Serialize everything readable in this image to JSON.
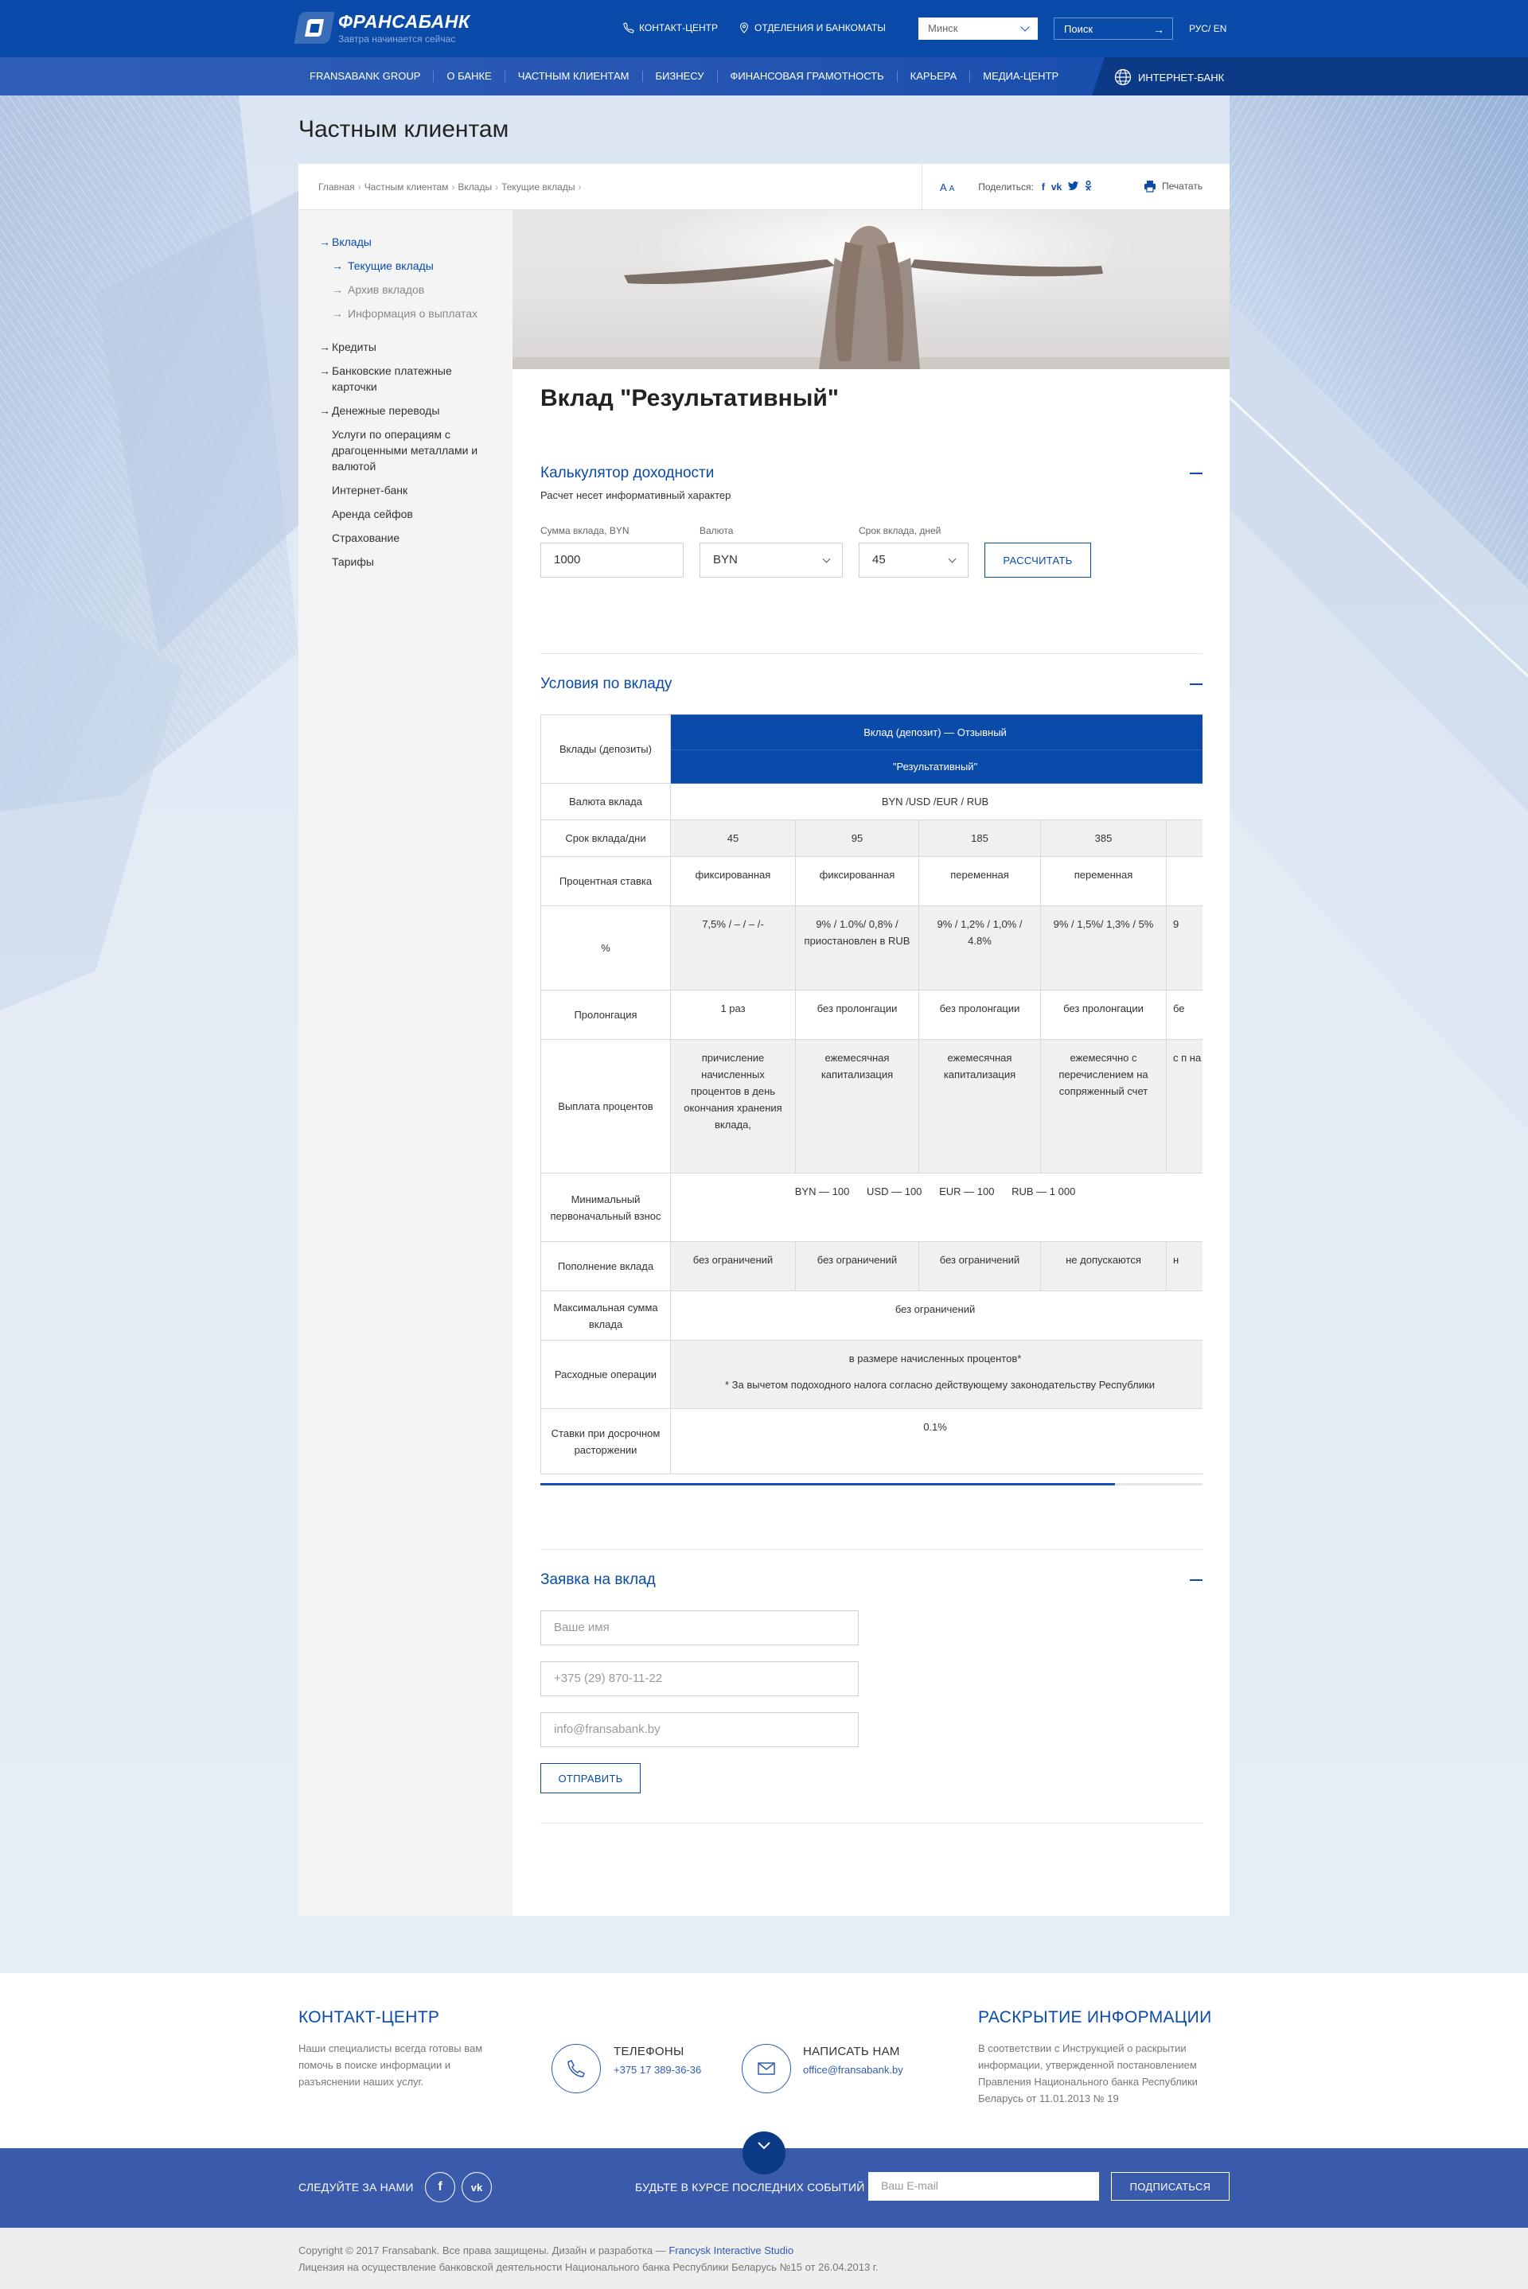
{
  "header": {
    "logo_name": "ФРАНСАБАНК",
    "logo_slogan": "Завтра начинается сейчас",
    "contact_center": "КОНТАКТ-ЦЕНТР",
    "branches": "ОТДЕЛЕНИЯ И БАНКОМАТЫ",
    "city": "Минск",
    "search_placeholder": "Поиск",
    "lang": "РУС/ EN"
  },
  "nav": {
    "items": [
      "FRANSABANK GROUP",
      "О БАНКЕ",
      "ЧАСТНЫМ КЛИЕНТАМ",
      "БИЗНЕСУ",
      "ФИНАНСОВАЯ ГРАМОТНОСТЬ",
      "КАРЬЕРА",
      "МЕДИА-ЦЕНТР"
    ],
    "internet_bank": "ИНТЕРНЕТ-БАНК"
  },
  "page": {
    "title": "Частным клиентам",
    "breadcrumbs": [
      "Главная",
      "Частным клиентам",
      "Вклады",
      "Текущие вклады"
    ],
    "font_size_label": "A",
    "font_size_label_small": "A",
    "share_label": "Поделиться:",
    "share_icons": [
      "f",
      "vk",
      "tw",
      "ok"
    ],
    "print_label": "Печатать"
  },
  "sidebar": {
    "items": [
      {
        "label": "Вклады",
        "active": true
      },
      {
        "label": "Текущие вклады",
        "sub": true,
        "active": true
      },
      {
        "label": "Архив вкладов",
        "sub": true
      },
      {
        "label": "Информация о выплатах",
        "sub": true
      },
      {
        "label": "Кредиты"
      },
      {
        "label": "Банковские платежные карточки"
      },
      {
        "label": "Денежные переводы"
      },
      {
        "label": "Услуги по операциям с драгоценными металлами и валютой"
      },
      {
        "label": "Интернет-банк"
      },
      {
        "label": "Аренда сейфов"
      },
      {
        "label": "Страхование"
      },
      {
        "label": "Тарифы"
      }
    ]
  },
  "product": {
    "title": "Вклад \"Результативный\""
  },
  "calculator": {
    "title": "Калькулятор доходности",
    "note": "Расчет несет информативный характер",
    "amount_label": "Сумма вклада, BYN",
    "amount_value": "1000",
    "currency_label": "Валюта",
    "currency_value": "BYN",
    "term_label": "Срок вклада, дней",
    "term_value": "45",
    "calc_button": "РАССЧИТАТЬ"
  },
  "terms": {
    "title": "Условия по вкладу",
    "header_top": "Вклад (депозит) — Отзывный",
    "header_name": "\"Результативный\"",
    "rows": {
      "deposits": "Вклады (депозиты)",
      "currency": "Валюта вклада",
      "currency_value": "BYN /USD /EUR / RUB",
      "term": "Срок вклада/дни",
      "terms": [
        "45",
        "95",
        "185",
        "385",
        ""
      ],
      "rate_type": "Процентная ставка",
      "rate_types": [
        "фиксированная",
        "фиксированная",
        "переменная",
        "переменная",
        ""
      ],
      "percent": "%",
      "percents": [
        "7,5% / – / – /-",
        "9% / 1.0%/ 0,8% / приостановлен в RUB",
        "9% / 1,2% / 1,0% / 4.8%",
        "9% / 1,5%/ 1,3% / 5%",
        "9"
      ],
      "prolongation": "Пролонгация",
      "prolongations": [
        "1 раз",
        "без пролонгации",
        "без пролонгации",
        "без пролонгации",
        "бе"
      ],
      "payout": "Выплата процентов",
      "payouts": [
        "причисление начисленных процентов в день окончания хранения вклада,",
        "ежемесячная капитализация",
        "ежемесячная капитализация",
        "ежемесячно с перечислением на сопряженный счет",
        "с п на"
      ],
      "min_deposit": "Минимальный первоначальный взнос",
      "min_values": "BYN — 100      USD — 100      EUR — 100      RUB — 1 000",
      "topup": "Пополнение вклада",
      "topups": [
        "без ограничений",
        "без ограничений",
        "без ограничений",
        "не допускаются",
        "н"
      ],
      "max_sum": "Максимальная сумма вклада",
      "max_value": "без ограничений",
      "expense": "Расходные операции",
      "expense_value": "в размере начисленных процентов*",
      "expense_note": "* За вычетом подоходного налога согласно действующему законодательству Республики",
      "early": "Ставки при досрочном расторжении",
      "early_value": "0.1%"
    }
  },
  "application": {
    "title": "Заявка на вклад",
    "name_placeholder": "Ваше имя",
    "phone_placeholder": "+375 (29) 870-11-22",
    "email_placeholder": "info@fransabank.by",
    "submit": "ОТПРАВИТЬ"
  },
  "footer": {
    "contact_title": "КОНТАКТ-ЦЕНТР",
    "contact_text": "Наши специалисты всегда готовы вам помочь в поиске информации и разъяснении наших услуг.",
    "phones_title": "ТЕЛЕФОНЫ",
    "phone": "+375 17 389-36-36",
    "write_title": "НАПИСАТЬ НАМ",
    "email": "office@fransabank.by",
    "disclosure_title": "РАСКРЫТИЕ ИНФОРМАЦИИ",
    "disclosure_text": "В соответствии с Инструкцией о раскрытии информации, утвержденной постановлением Правления Национального банка Республики Беларусь от 11.01.2013 № 19",
    "follow": "СЛЕДУЙТЕ ЗА НАМИ",
    "social": [
      "f",
      "vk"
    ],
    "news": "БУДЬТЕ В КУРСЕ ПОСЛЕДНИХ СОБЫТИЙ",
    "email_placeholder": "Ваш E-mail",
    "subscribe": "ПОДПИСАТЬСЯ",
    "copyright": "Copyright © 2017 Fransabank. Все права защищены. Дизайн и разработка — ",
    "studio": "Francysk Interactive Studio",
    "license": "Лицензия на осуществление банковской деятельности Национального банка Республики Беларусь №15 от 26.04.2013 г."
  },
  "colors": {
    "brand": "#0a4aa8",
    "nav": "#1751b3",
    "footer_band": "#3a5aab"
  }
}
